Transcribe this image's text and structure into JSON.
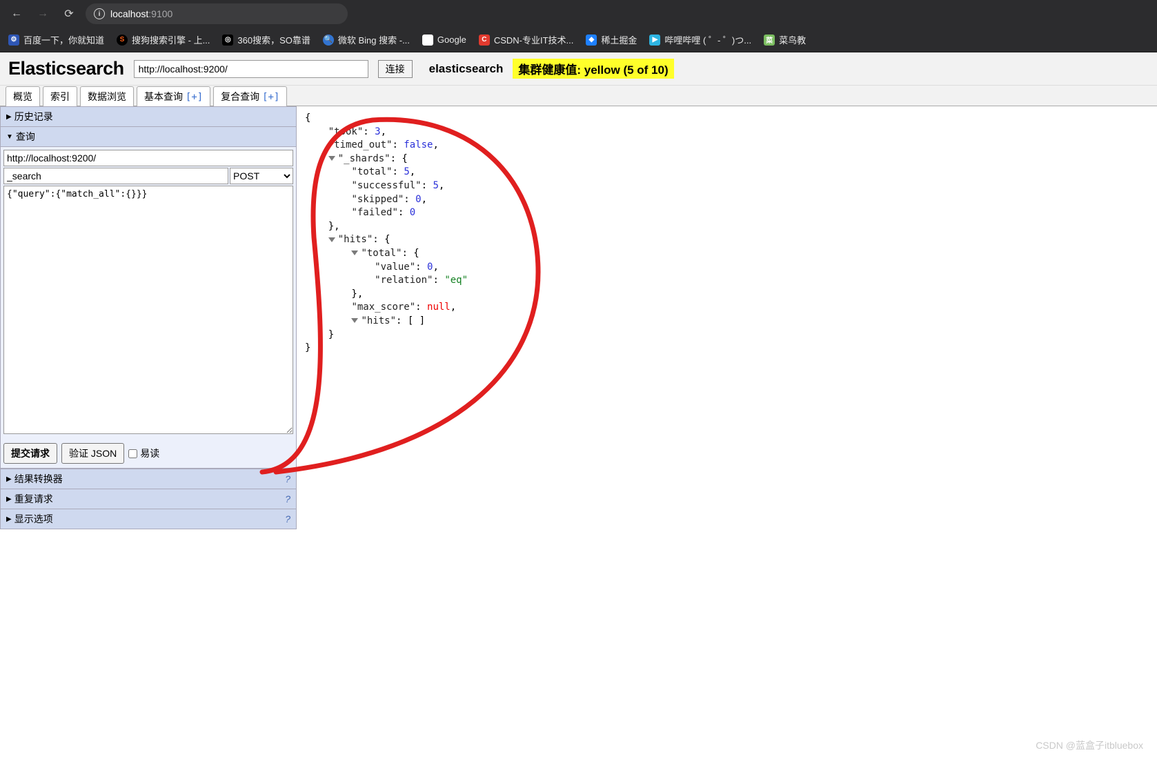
{
  "browser": {
    "url_host": "localhost",
    "url_rest": ":9100"
  },
  "bookmarks": [
    {
      "fav": "fav-baidu",
      "glyph": "⚙",
      "label": "百度一下，你就知道"
    },
    {
      "fav": "fav-sogou",
      "glyph": "S",
      "label": "搜狗搜索引擎 - 上..."
    },
    {
      "fav": "fav-360",
      "glyph": "◎",
      "label": "360搜索，SO靠谱"
    },
    {
      "fav": "fav-bing",
      "glyph": "🔍",
      "label": "微软 Bing 搜索 -..."
    },
    {
      "fav": "fav-google",
      "glyph": "G",
      "label": "Google"
    },
    {
      "fav": "fav-csdn",
      "glyph": "C",
      "label": "CSDN-专业IT技术..."
    },
    {
      "fav": "fav-juejin",
      "glyph": "◆",
      "label": "稀土掘金"
    },
    {
      "fav": "fav-bili",
      "glyph": "▶",
      "label": "哔哩哔哩 (  ゜- ゜)つ..."
    },
    {
      "fav": "fav-runoob",
      "glyph": "菜",
      "label": "菜鸟教"
    }
  ],
  "header": {
    "logo": "Elasticsearch",
    "connect_url": "http://localhost:9200/",
    "connect_btn": "连接",
    "cluster_name": "elasticsearch",
    "health_text": "集群健康值: yellow (5 of 10)"
  },
  "tabs": [
    {
      "label": "概览",
      "plus": ""
    },
    {
      "label": "索引",
      "plus": ""
    },
    {
      "label": "数据浏览",
      "plus": ""
    },
    {
      "label": "基本查询 ",
      "plus": "[+]"
    },
    {
      "label": "复合查询 ",
      "plus": "[+]"
    }
  ],
  "sidebar": {
    "history_label": "历史记录",
    "query_label": "查询",
    "query_host": "http://localhost:9200/",
    "query_path": "_search",
    "method": "POST",
    "query_body": "{\"query\":{\"match_all\":{}}}",
    "submit_label": "提交请求",
    "validate_label": "验证 JSON",
    "readable_label": "易读",
    "transformer_label": "结果转换器",
    "repeat_label": "重复请求",
    "display_label": "显示选项"
  },
  "json_result": {
    "took": 3,
    "timed_out": false,
    "_shards": {
      "total": 5,
      "successful": 5,
      "skipped": 0,
      "failed": 0
    },
    "hits": {
      "total": {
        "value": 0,
        "relation": "eq"
      },
      "max_score": null,
      "hits": []
    }
  },
  "watermark": "CSDN @蓝盒子itbluebox"
}
